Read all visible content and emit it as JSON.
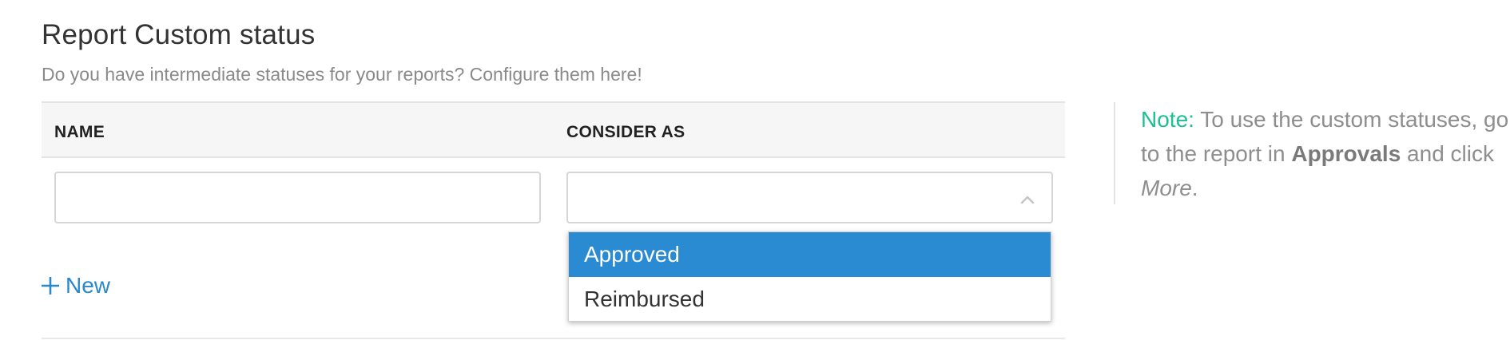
{
  "header": {
    "title": "Report Custom status",
    "subtitle": "Do you have intermediate statuses for your reports? Configure them here!"
  },
  "table": {
    "columns": [
      "NAME",
      "CONSIDER AS"
    ],
    "row": {
      "name_value": "",
      "consider_value": ""
    }
  },
  "dropdown": {
    "options": [
      "Approved",
      "Reimbursed"
    ],
    "selected": "Approved"
  },
  "actions": {
    "new_label": "New"
  },
  "note": {
    "label": "Note:",
    "text_1": " To use the custom statuses, go to the report in ",
    "strong": "Approvals",
    "text_2": " and click ",
    "emphasis": "More",
    "text_3": "."
  },
  "colors": {
    "accent_blue": "#2a88cc",
    "selected_option": "#2a8bd2",
    "note_label": "#1fbf94"
  }
}
